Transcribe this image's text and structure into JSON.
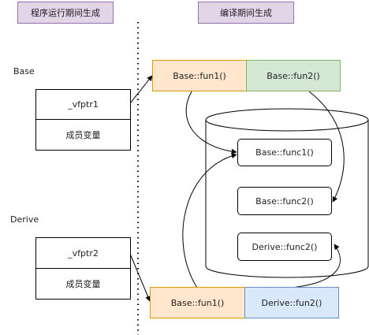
{
  "headers": {
    "runtime": "程序运行期间生成",
    "compile": "编译期间生成"
  },
  "base": {
    "class_label": "Base",
    "vptr": "_vfptr1",
    "members": "成员变量"
  },
  "derive": {
    "class_label": "Derive",
    "vptr": "_vfptr2",
    "members": "成员变量"
  },
  "base_vtable": {
    "slot1": "Base::fun1()",
    "slot2": "Base::fun2()"
  },
  "derive_vtable": {
    "slot1": "Base::fun1()",
    "slot2": "Derive::fun2()"
  },
  "code_segment": {
    "func1": "Base::func1()",
    "func2": "Base::func2()",
    "func3": "Derive::func2()"
  },
  "colors": {
    "header_fill": "#e1d5e7",
    "orange_fill": "#ffe6cc",
    "green_fill": "#d5e8d4",
    "blue_fill": "#dae8fc"
  }
}
